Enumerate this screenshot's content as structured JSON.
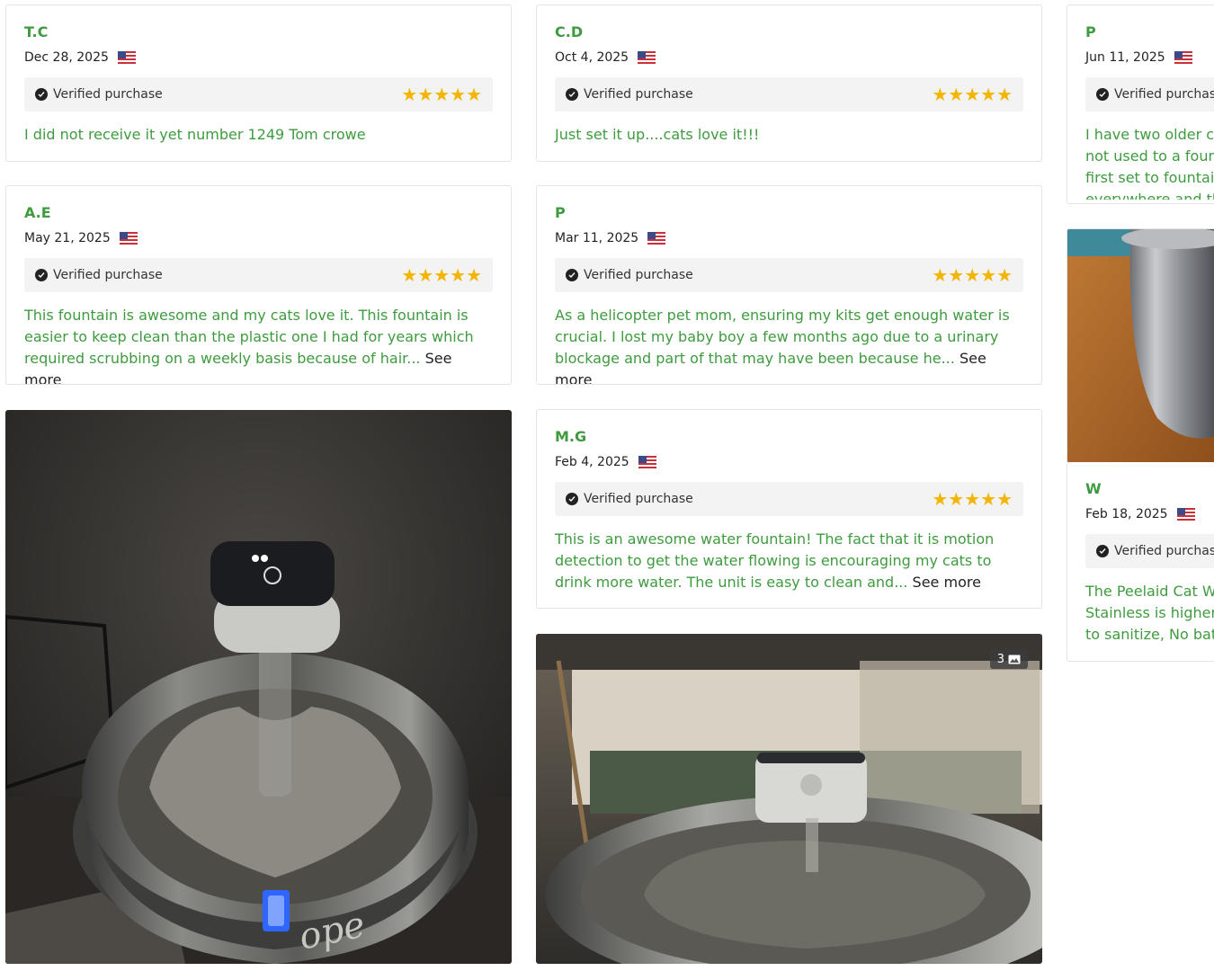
{
  "reviews": [
    {
      "name": "T.C",
      "date": "Dec 28, 2025",
      "verified": "Verified purchase",
      "stars": "★★★★★",
      "text": "I did not receive it yet number 1249 Tom crowe",
      "see_more": ""
    },
    {
      "name": "C.D",
      "date": "Oct 4, 2025",
      "verified": "Verified purchase",
      "stars": "★★★★★",
      "text": "Just set it up....cats love it!!!",
      "see_more": ""
    },
    {
      "name": "P",
      "date": "Jun 11, 2025",
      "verified": "Verified purchase",
      "stars": "★★★★★",
      "text": "I have two older cats that were not used to a fountain. When I first set to fountain water went everywhere and that freaked me out",
      "see_more": ""
    },
    {
      "name": "A.E",
      "date": "May 21, 2025",
      "verified": "Verified purchase",
      "stars": "★★★★★",
      "text": "This fountain is awesome and my cats love it. This fountain is easier to keep clean than the plastic one I had for years which required scrubbing on a weekly basis because of hair...",
      "see_more": "See more"
    },
    {
      "name": "P",
      "date": "Mar 11, 2025",
      "verified": "Verified purchase",
      "stars": "★★★★★",
      "text": "As a helicopter pet mom, ensuring my kits get enough water is crucial. I lost my baby boy a few months ago due to a urinary blockage and part of that may have been because he...",
      "see_more": "See more"
    },
    {
      "name": "M.G",
      "date": "Feb 4, 2025",
      "verified": "Verified purchase",
      "stars": "★★★★★",
      "text": "This is an awesome water fountain! The fact that it is motion detection to get the water flowing is encouraging my cats to drink more water. The unit is easy to clean and...",
      "see_more": "See more"
    },
    {
      "name": "W",
      "date": "Feb 18, 2025",
      "verified": "Verified purchase",
      "stars": "★★★★★",
      "text": "The Peelaid Cat Water Fountain Stainless is higher quality, easy to sanitize, No battery",
      "see_more": ""
    }
  ],
  "photo_badge": {
    "count": "3"
  },
  "colors": {
    "name_green": "#3f9b3f",
    "star": "#f5b400"
  }
}
